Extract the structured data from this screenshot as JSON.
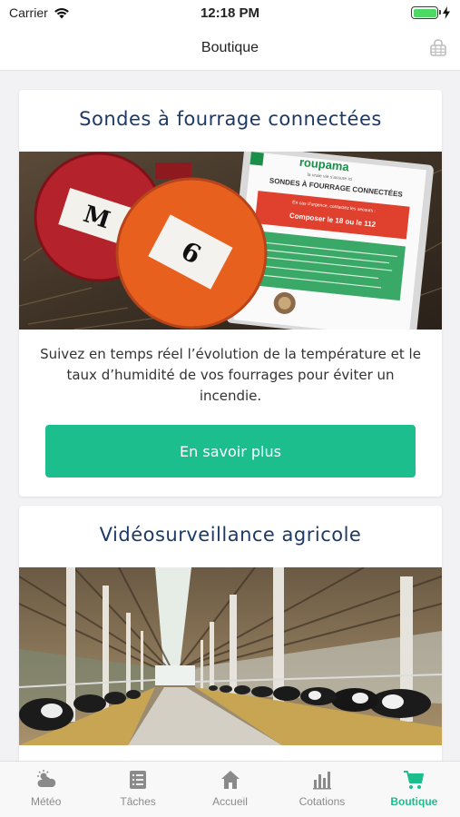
{
  "status": {
    "carrier": "Carrier",
    "time": "12:18 PM"
  },
  "header": {
    "title": "Boutique",
    "cart_icon": "basket-icon"
  },
  "cards": [
    {
      "title": "Sondes à fourrage connectées",
      "image": {
        "probe_labels": [
          "M",
          "6"
        ],
        "sign_brand": "roupama",
        "sign_tagline": "la vraie vie s'assure ici",
        "sign_title": "SONDES À FOURRAGE CONNECTÉES",
        "sign_alert_small": "En cas d'urgence, contactez les secours :",
        "sign_alert_main": "Composer le 18 ou le 112"
      },
      "description": "Suivez en temps réel l’évolution de la température et le taux d’humidité de vos fourrages pour éviter un incendie.",
      "button_label": "En savoir plus"
    },
    {
      "title": "Vidéosurveillance agricole",
      "image": {}
    }
  ],
  "tabs": [
    {
      "label": "Météo",
      "icon": "weather-icon",
      "active": false
    },
    {
      "label": "Tâches",
      "icon": "tasks-icon",
      "active": false
    },
    {
      "label": "Accueil",
      "icon": "home-icon",
      "active": false
    },
    {
      "label": "Cotations",
      "icon": "chart-icon",
      "active": false
    },
    {
      "label": "Boutique",
      "icon": "cart-icon",
      "active": true
    }
  ],
  "colors": {
    "accent": "#1cbe8e",
    "title": "#1d3a66",
    "tab_inactive": "#8a8a8a",
    "battery": "#4cd964"
  }
}
